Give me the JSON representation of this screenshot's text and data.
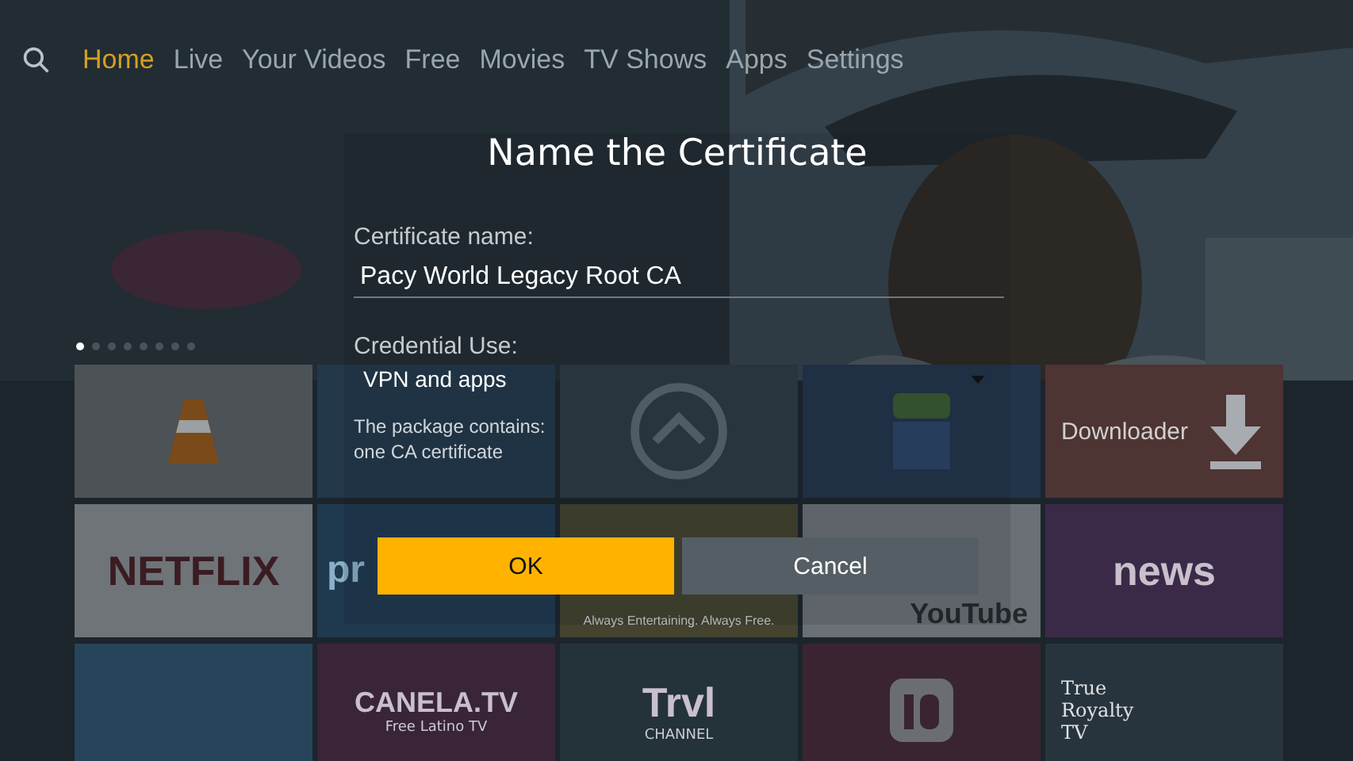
{
  "nav": {
    "items": [
      {
        "label": "Home",
        "selected": true
      },
      {
        "label": "Live",
        "selected": false
      },
      {
        "label": "Your Videos",
        "selected": false
      },
      {
        "label": "Free",
        "selected": false
      },
      {
        "label": "Movies",
        "selected": false
      },
      {
        "label": "TV Shows",
        "selected": false
      },
      {
        "label": "Apps",
        "selected": false
      },
      {
        "label": "Settings",
        "selected": false
      }
    ]
  },
  "hero": {
    "dots": [
      {
        "selected": true
      },
      {
        "selected": false
      },
      {
        "selected": false
      },
      {
        "selected": false
      },
      {
        "selected": false
      },
      {
        "selected": false
      },
      {
        "selected": false
      },
      {
        "selected": false
      }
    ]
  },
  "tiles": [
    {
      "kind": "cone",
      "color": "#4c5256"
    },
    {
      "kind": "blank",
      "color": "#23384a"
    },
    {
      "kind": "ring",
      "color": "#2c3a44"
    },
    {
      "kind": "android",
      "color": "#22344a"
    },
    {
      "kind": "download",
      "color": "#4e3432",
      "label": "Downloader"
    },
    {
      "kind": "wordmark",
      "color": "#6e7478",
      "label": "NETFLIX"
    },
    {
      "kind": "partial",
      "color": "#1f3a4f",
      "label": "pr"
    },
    {
      "kind": "tagline",
      "color": "#43432f",
      "sub": "Always Entertaining. Always Free."
    },
    {
      "kind": "lowmark",
      "color": "#6a7076",
      "label": "YouTube"
    },
    {
      "kind": "wordmark",
      "color": "#3a2a48",
      "label": "news"
    },
    {
      "kind": "blank",
      "color": "#27455a"
    },
    {
      "kind": "wordmark",
      "color": "#3a2438",
      "label": "CANELA.TV",
      "sub": "Free Latino TV"
    },
    {
      "kind": "wordmark",
      "color": "#24323a",
      "label": "Trvl",
      "sub": "CHANNEL"
    },
    {
      "kind": "badge",
      "color": "#3a2432"
    },
    {
      "kind": "stack",
      "color": "#27343e",
      "label": "True Royalty TV"
    }
  ],
  "dialog": {
    "title": "Name the Certificate",
    "name_label": "Certificate name:",
    "name_value": "Pacy World Legacy Root CA",
    "use_label": "Credential Use:",
    "use_value": "VPN and apps",
    "info_lines": [
      "The package contains:",
      "one CA certificate"
    ],
    "buttons": [
      {
        "label": "OK",
        "selected": true
      },
      {
        "label": "Cancel",
        "selected": false
      }
    ]
  }
}
